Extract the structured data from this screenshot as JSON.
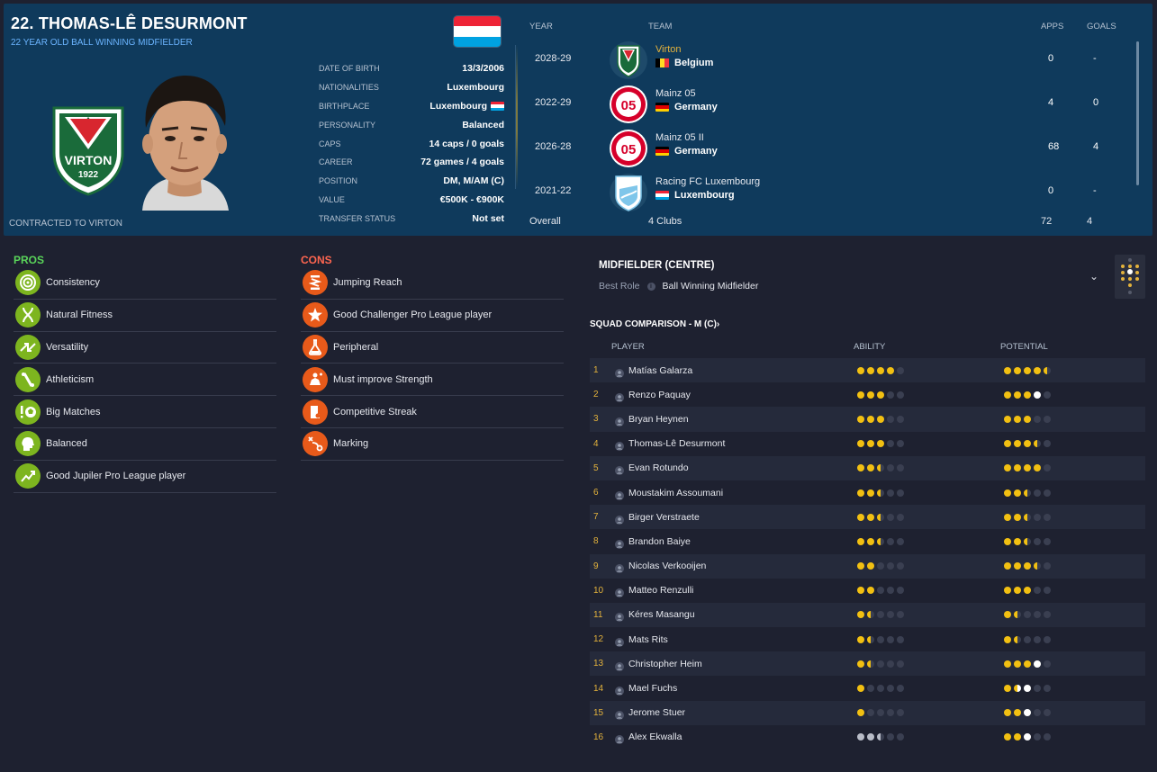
{
  "player": {
    "name": "22. THOMAS-LÊ DESURMONT",
    "subtitle": "22 YEAR OLD  BALL WINNING MIDFIELDER",
    "contracted": "CONTRACTED TO VIRTON",
    "badge_text": "VIRTON",
    "badge_year": "1922"
  },
  "info": [
    {
      "label": "DATE OF BIRTH",
      "value": "13/3/2006"
    },
    {
      "label": "NATIONALITIES",
      "value": "Luxembourg"
    },
    {
      "label": "BIRTHPLACE",
      "value": "Luxembourg"
    },
    {
      "label": "PERSONALITY",
      "value": "Balanced"
    },
    {
      "label": "CAPS",
      "value": "14 caps / 0 goals"
    },
    {
      "label": "CAREER",
      "value": "72 games /    4 goals"
    },
    {
      "label": "POSITION",
      "value": "DM, M/AM (C)"
    },
    {
      "label": "VALUE",
      "value": "€500K - €900K"
    },
    {
      "label": "TRANSFER STATUS",
      "value": "Not set"
    }
  ],
  "career": {
    "headers": {
      "year": "YEAR",
      "team": "TEAM",
      "apps": "APPS",
      "goals": "GOALS"
    },
    "rows": [
      {
        "year": "2028-29",
        "club": "Virton",
        "country": "Belgium",
        "apps": "0",
        "goals": "-"
      },
      {
        "year": "2022-29",
        "club": "Mainz 05",
        "country": "Germany",
        "apps": "4",
        "goals": "0"
      },
      {
        "year": "2026-28",
        "club": "Mainz 05 II",
        "country": "Germany",
        "apps": "68",
        "goals": "4"
      },
      {
        "year": "2021-22",
        "club": "Racing FC Luxembourg",
        "country": "Luxembourg",
        "apps": "0",
        "goals": "-"
      }
    ],
    "overall": {
      "label": "Overall",
      "clubs": "4 Clubs",
      "apps": "72",
      "goals": "4"
    }
  },
  "pros": {
    "title": "PROS",
    "items": [
      "Consistency",
      "Natural Fitness",
      "Versatility",
      "Athleticism",
      "Big Matches",
      "Balanced",
      "Good Jupiler Pro League player"
    ]
  },
  "cons": {
    "title": "CONS",
    "items": [
      "Jumping Reach",
      "Good Challenger Pro League player",
      "Peripheral",
      "Must improve Strength",
      "Competitive Streak",
      "Marking"
    ]
  },
  "role": {
    "title": "MIDFIELDER (CENTRE)",
    "best_role_label": "Best Role",
    "best_role_value": "Ball Winning Midfielder"
  },
  "squad": {
    "title": "SQUAD COMPARISON - M (C)",
    "headers": {
      "player": "PLAYER",
      "ability": "ABILITY",
      "potential": "POTENTIAL"
    },
    "rows": [
      {
        "num": "1",
        "name": "Matías Galarza",
        "ability": 4,
        "potential": 4.5
      },
      {
        "num": "2",
        "name": "Renzo Paquay",
        "ability": 3,
        "potential": 3,
        "pot_white": 1
      },
      {
        "num": "3",
        "name": "Bryan Heynen",
        "ability": 3,
        "potential": 3
      },
      {
        "num": "4",
        "name": "Thomas-Lê Desurmont",
        "ability": 3,
        "potential": 3.5
      },
      {
        "num": "5",
        "name": "Evan Rotundo",
        "ability": 2.5,
        "potential": 4
      },
      {
        "num": "6",
        "name": "Moustakim Assoumani",
        "ability": 2.5,
        "potential": 2.5
      },
      {
        "num": "7",
        "name": "Birger Verstraete",
        "ability": 2.5,
        "potential": 2.5
      },
      {
        "num": "8",
        "name": "Brandon Baiye",
        "ability": 2.5,
        "potential": 2.5
      },
      {
        "num": "9",
        "name": "Nicolas Verkooijen",
        "ability": 2,
        "potential": 3.5
      },
      {
        "num": "10",
        "name": "Matteo Renzulli",
        "ability": 2,
        "potential": 3
      },
      {
        "num": "11",
        "name": "Kéres Masangu",
        "ability": 1.5,
        "potential": 1.5
      },
      {
        "num": "12",
        "name": "Mats Rits",
        "ability": 1.5,
        "potential": 1.5
      },
      {
        "num": "13",
        "name": "Christopher Heim",
        "ability": 1.5,
        "potential": 3,
        "pot_white": 1
      },
      {
        "num": "14",
        "name": "Mael Fuchs",
        "ability": 1,
        "potential": 1,
        "pot_whalf": 1,
        "pot_white": 1
      },
      {
        "num": "15",
        "name": "Jerome Stuer",
        "ability": 1,
        "potential": 2,
        "pot_white": 1
      },
      {
        "num": "16",
        "name": "Alex Ekwalla",
        "ability": 0,
        "abil_grey": 2.5,
        "potential": 2,
        "pot_white": 1
      }
    ]
  },
  "colors": {
    "accent": "#e3b23c",
    "pros": "#5ad55a",
    "cons": "#ff6650",
    "header_bg": "#0f3a5c"
  }
}
